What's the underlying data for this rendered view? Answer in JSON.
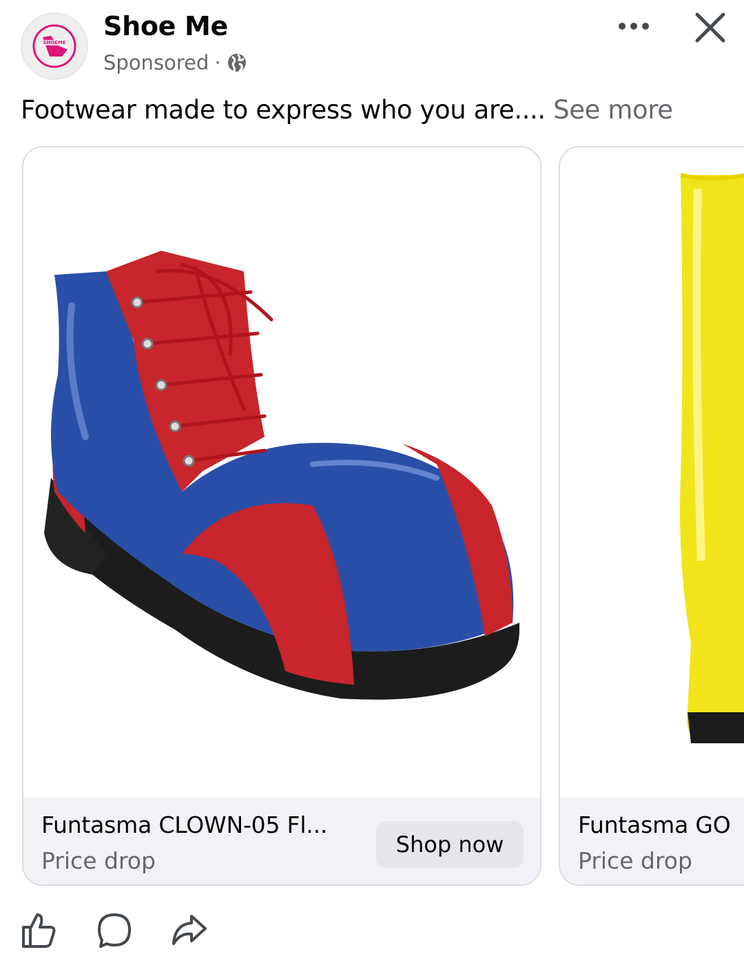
{
  "post": {
    "page_name": "Shoe Me",
    "sponsored": "Sponsored",
    "separator": "·",
    "avatar_logo_text": "SHOEME",
    "caption": "Footwear made to express who you are....",
    "see_more": "See more"
  },
  "icons": {
    "more": "more-horizontal-icon",
    "close": "close-icon",
    "audience": "globe-icon",
    "like": "thumbs-up-icon",
    "comment": "comment-icon",
    "share": "share-icon"
  },
  "cards": [
    {
      "title": "Funtasma CLOWN-05 Fl...",
      "subtitle": "Price drop",
      "cta": "Shop now",
      "image": "red-blue-clown-shoe"
    },
    {
      "title": "Funtasma GO",
      "subtitle": "Price drop",
      "image": "yellow-patent-boot"
    }
  ],
  "colors": {
    "brand_pink": "#e0157a",
    "secondary_text": "#65676b",
    "footer_bg": "#f0f2f5"
  }
}
